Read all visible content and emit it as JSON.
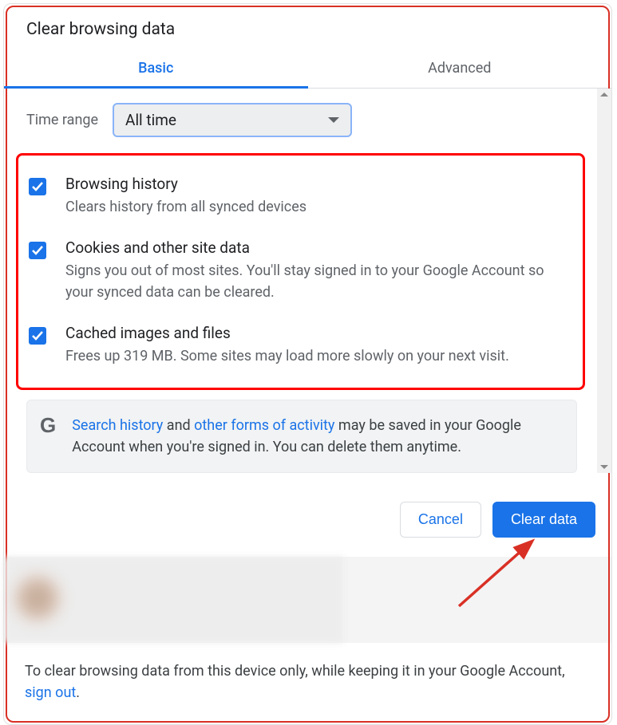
{
  "title": "Clear browsing data",
  "tabs": {
    "basic": "Basic",
    "advanced": "Advanced"
  },
  "time_range": {
    "label": "Time range",
    "value": "All time"
  },
  "checks": [
    {
      "title": "Browsing history",
      "desc": "Clears history from all synced devices"
    },
    {
      "title": "Cookies and other site data",
      "desc": "Signs you out of most sites. You'll stay signed in to your Google Account so your synced data can be cleared."
    },
    {
      "title": "Cached images and files",
      "desc": "Frees up 319 MB. Some sites may load more slowly on your next visit."
    }
  ],
  "info": {
    "link1": "Search history",
    "middle": " and ",
    "link2": "other forms of activity",
    "rest": " may be saved in your Google Account when you're signed in. You can delete them anytime."
  },
  "buttons": {
    "cancel": "Cancel",
    "clear": "Clear data"
  },
  "footer": {
    "text_before": "To clear browsing data from this device only, while keeping it in your Google Account, ",
    "link": "sign out",
    "text_after": "."
  }
}
